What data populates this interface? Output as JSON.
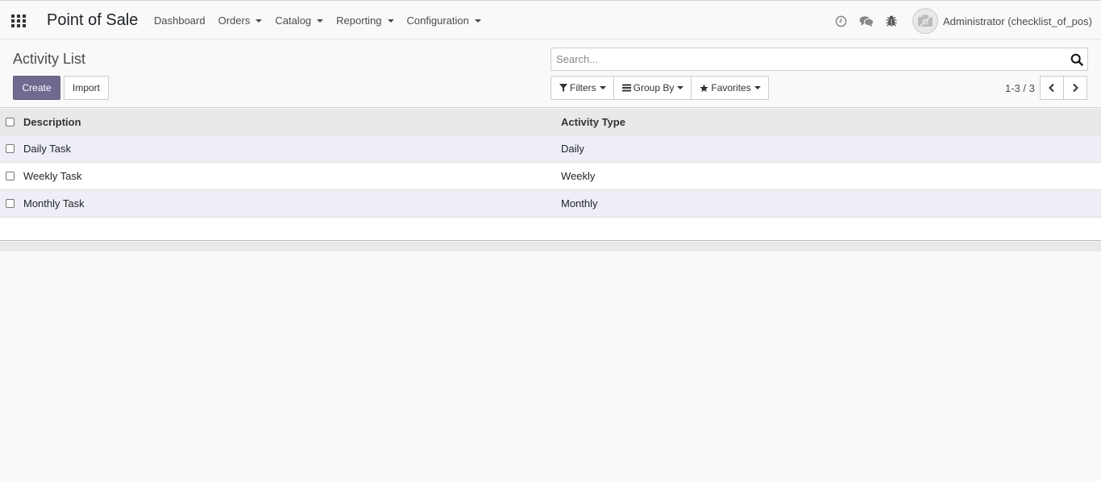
{
  "navbar": {
    "app_title": "Point of Sale",
    "menu": [
      {
        "label": "Dashboard",
        "dropdown": false
      },
      {
        "label": "Orders",
        "dropdown": true
      },
      {
        "label": "Catalog",
        "dropdown": true
      },
      {
        "label": "Reporting",
        "dropdown": true
      },
      {
        "label": "Configuration",
        "dropdown": true
      }
    ],
    "systray_icons": [
      "clock-icon",
      "chat-icon",
      "bug-icon"
    ],
    "user_name": "Administrator (checklist_of_pos)"
  },
  "control_panel": {
    "breadcrumb": "Activity List",
    "create_label": "Create",
    "import_label": "Import",
    "search_placeholder": "Search...",
    "filters_label": "Filters",
    "group_by_label": "Group By",
    "favorites_label": "Favorites",
    "pager_value": "1-3 / 3"
  },
  "table": {
    "columns": [
      "Description",
      "Activity Type"
    ],
    "rows": [
      [
        "Daily Task",
        "Daily"
      ],
      [
        "Weekly Task",
        "Weekly"
      ],
      [
        "Monthly Task",
        "Monthly"
      ]
    ]
  },
  "colors": {
    "primary": "#6f6a8f",
    "row_stripe": "#eeeef6",
    "header_bg": "#e9e9e9"
  }
}
